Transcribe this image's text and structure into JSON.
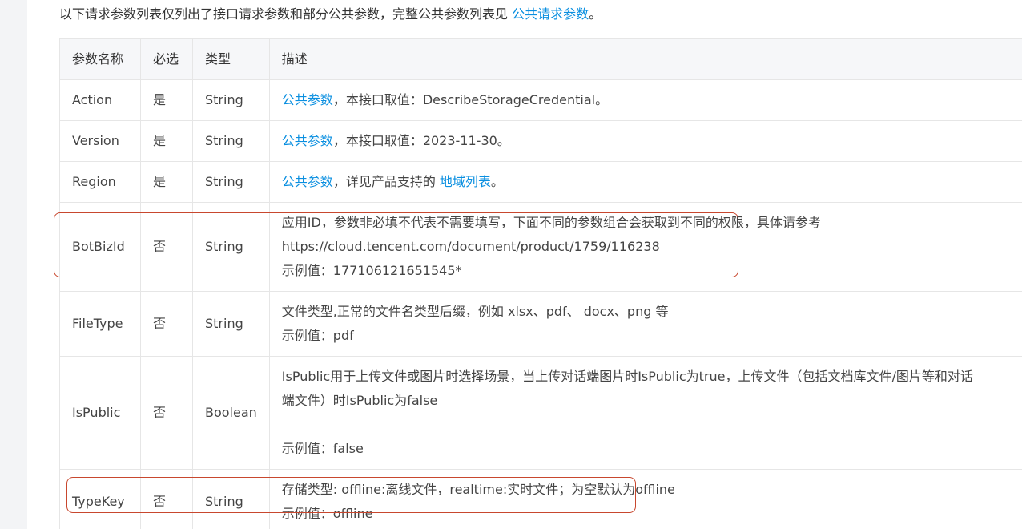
{
  "intro": {
    "text": "以下请求参数列表仅列出了接口请求参数和部分公共参数，完整公共参数列表见 ",
    "link": "公共请求参数",
    "suffix": "。"
  },
  "table": {
    "headers": [
      "参数名称",
      "必选",
      "类型",
      "描述"
    ],
    "rows": [
      {
        "name": "Action",
        "required": "是",
        "type": "String",
        "desc_link": "公共参数",
        "desc_text": "，本接口取值：DescribeStorageCredential。"
      },
      {
        "name": "Version",
        "required": "是",
        "type": "String",
        "desc_link": "公共参数",
        "desc_text": "，本接口取值：2023-11-30。"
      },
      {
        "name": "Region",
        "required": "是",
        "type": "String",
        "desc_link": "公共参数",
        "desc_text": "，详见产品支持的 ",
        "desc_link2": "地域列表",
        "desc_suffix": "。"
      },
      {
        "name": "BotBizId",
        "required": "否",
        "type": "String",
        "desc_lines": [
          "应用ID，参数非必填不代表不需要填写，下面不同的参数组合会获取到不同的权限，具体请参考",
          "https://cloud.tencent.com/document/product/1759/116238",
          "示例值：177106121651545*"
        ]
      },
      {
        "name": "FileType",
        "required": "否",
        "type": "String",
        "desc_lines": [
          "文件类型,正常的文件名类型后缀，例如 xlsx、pdf、 docx、png 等",
          "示例值：pdf"
        ]
      },
      {
        "name": "IsPublic",
        "required": "否",
        "type": "Boolean",
        "desc_lines": [
          "IsPublic用于上传文件或图片时选择场景，当上传对话端图片时IsPublic为true，上传文件（包括文档库文件/图片等和对话",
          "端文件）时IsPublic为false",
          "示例值：false"
        ]
      },
      {
        "name": "TypeKey",
        "required": "否",
        "type": "String",
        "desc_lines": [
          "存储类型: offline:离线文件，realtime:实时文件；为空默认为offline",
          "示例值：offline"
        ]
      }
    ]
  },
  "colors": {
    "link": "#0a8fe0",
    "highlight_border": "#c8472e",
    "header_bg": "#f6f7f9"
  }
}
